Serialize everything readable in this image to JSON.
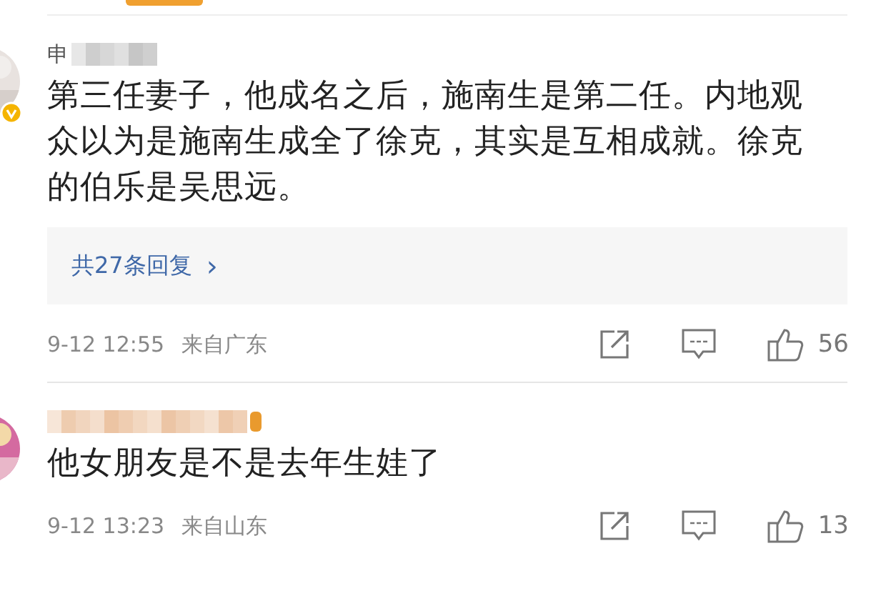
{
  "comments": [
    {
      "author": "申",
      "verified": true,
      "text": "第三任妻子，他成名之后，施南生是第二任。内地观众以为是施南生成全了徐克，其实是互相成就。徐克的伯乐是吴思远。",
      "replies": {
        "label": "共27条回复",
        "arrow": "›"
      },
      "time": "9-12 12:55",
      "source": "来自广东",
      "likes": "56"
    },
    {
      "verified": false,
      "text": "他女朋友是不是去年生娃了",
      "time": "9-12 13:23",
      "source": "来自山东",
      "likes": "13"
    }
  ]
}
